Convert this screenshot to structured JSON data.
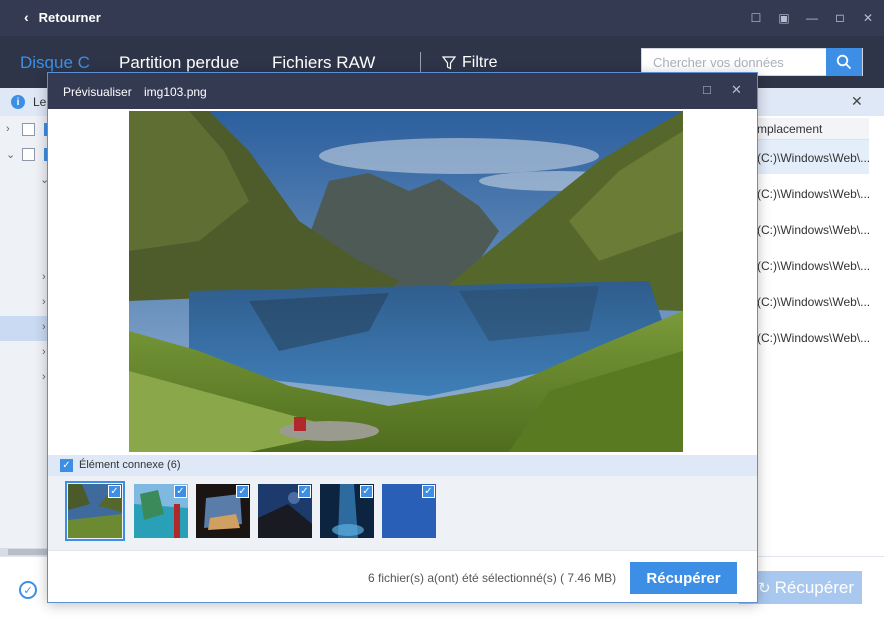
{
  "titlebar": {
    "back_label": "Retourner"
  },
  "nav": {
    "tabs": [
      {
        "label": "Disque C"
      },
      {
        "label": "Partition perdue"
      },
      {
        "label": "Fichiers RAW"
      }
    ],
    "filter_label": "Filtre"
  },
  "search": {
    "placeholder": "Chercher vos données"
  },
  "infobar": {
    "text": "Le"
  },
  "table": {
    "header": "mplacement",
    "rows": [
      "(C:)\\Windows\\Web\\...",
      "(C:)\\Windows\\Web\\...",
      "(C:)\\Windows\\Web\\...",
      "(C:)\\Windows\\Web\\...",
      "(C:)\\Windows\\Web\\...",
      "(C:)\\Windows\\Web\\..."
    ]
  },
  "footer": {
    "recover_label": "Récupérer"
  },
  "modal": {
    "title": "Prévisualiser",
    "filename": "img103.png",
    "related_label": "Élément connexe (6)",
    "status": "6 fichier(s) a(ont) été sélectionné(s) ( 7.46 MB)",
    "recover_label": "Récupérer",
    "thumbnails": [
      {
        "name": "thumb-lake"
      },
      {
        "name": "thumb-beach"
      },
      {
        "name": "thumb-cave"
      },
      {
        "name": "thumb-night"
      },
      {
        "name": "thumb-waterfall"
      },
      {
        "name": "thumb-blue"
      }
    ]
  },
  "colors": {
    "accent": "#3d8fe6",
    "titlebar": "#343a52",
    "navbar": "#2f3549",
    "infobar": "#dfe8f6"
  }
}
